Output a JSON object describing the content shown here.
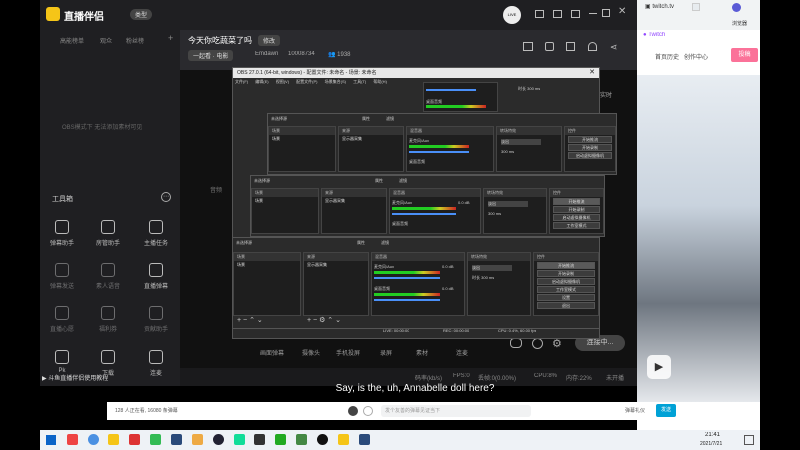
{
  "app": {
    "title": "直播伴侣",
    "type_btn": "类型",
    "user_initials": "LIVE",
    "stream_title": "今天你吃蔬菜了吗",
    "edit_btn": "修改",
    "category": "一起看 · 电影",
    "streamer": "Emdawn",
    "room_id": "10008734",
    "viewers": "1938",
    "left_tabs": [
      "高能榜单",
      "观众",
      "粉丝榜"
    ],
    "left_placeholder": "OBS模式下 无法添加素材可见",
    "toolbox_label": "工具箱",
    "tools": [
      {
        "label": "弹幕助手",
        "badge": ""
      },
      {
        "label": "房管助手",
        "badge": ""
      },
      {
        "label": "主播任务",
        "badge": ""
      },
      {
        "label": "弹幕发送",
        "badge": "HOT"
      },
      {
        "label": "素人语音",
        "badge": ""
      },
      {
        "label": "直播弹幕",
        "badge": "NEW"
      },
      {
        "label": "直播心愿",
        "badge": "NEW"
      },
      {
        "label": "福利券",
        "badge": ""
      },
      {
        "label": "贡献助手",
        "badge": ""
      },
      {
        "label": "Pk",
        "badge": "HOT"
      },
      {
        "label": "下载",
        "badge": ""
      },
      {
        "label": "连麦",
        "badge": ""
      }
    ],
    "bottom_tools": [
      "画面弹幕",
      "摄像头",
      "手机投屏",
      "录屏",
      "素材",
      "连麦"
    ],
    "connect_btn": "连接中...",
    "status": {
      "bitrate": "码率(kb/s)",
      "fps": "FPS:0",
      "drop": "丢帧:0(0.00%)",
      "cpu": "CPU:8%",
      "mem": "内存:22%",
      "notice": "未开播"
    },
    "tutorial": "斗鱼直播伴侣使用教程",
    "preview_label": "实时",
    "side_label": "音频"
  },
  "obs": {
    "title": "OBS 27.0.1 (64-bit, windows) - 配置文件: 未命名 - 场景: 未命名",
    "menu": [
      "文件(F)",
      "编辑(E)",
      "视图(V)",
      "配置文件(P)",
      "场景集合(S)",
      "工具(T)",
      "帮助(H)"
    ],
    "panels": {
      "scenes": "场景",
      "sources": "来源",
      "mixer": "混音器",
      "transitions": "转场特效",
      "controls": "控件"
    },
    "scene": "场景",
    "source": "显示器采集",
    "desktop_audio": "桌面音频",
    "mic": "麦克风/Aux",
    "db": "0.0 dB",
    "fade": "淡出",
    "duration_label": "时长",
    "duration": "300 ms",
    "controls": [
      "开始推流",
      "开始录制",
      "启动虚拟摄像机",
      "工作室模式",
      "设置",
      "退出"
    ],
    "status": {
      "live": "LIVE: 00:00:00",
      "rec": "REC: 00:00:00",
      "cpu": "CPU: 0.4%, 60.00 fps"
    },
    "stream_edit": "流 配置",
    "no_source": "未选择源",
    "properties": "属性",
    "filters": "滤镜"
  },
  "video": {
    "subtitle": "Say, is the, uh, Annabelle doll here?"
  },
  "browser": {
    "tab": "Twitch",
    "address": "twitch.tv",
    "links": [
      "首页",
      "历史",
      "创作中心"
    ],
    "login": "投稿",
    "sidebar": "浏览器"
  },
  "comment": {
    "info": "128 人正在看, 16080 条弹幕",
    "danmu_toggle": "弹幕",
    "placeholder": "发个友善的弹幕见证当下",
    "etiquette": "弹幕礼仪",
    "send": "发送"
  },
  "taskbar": {
    "time": "21:41",
    "date": "2021/7/21"
  }
}
